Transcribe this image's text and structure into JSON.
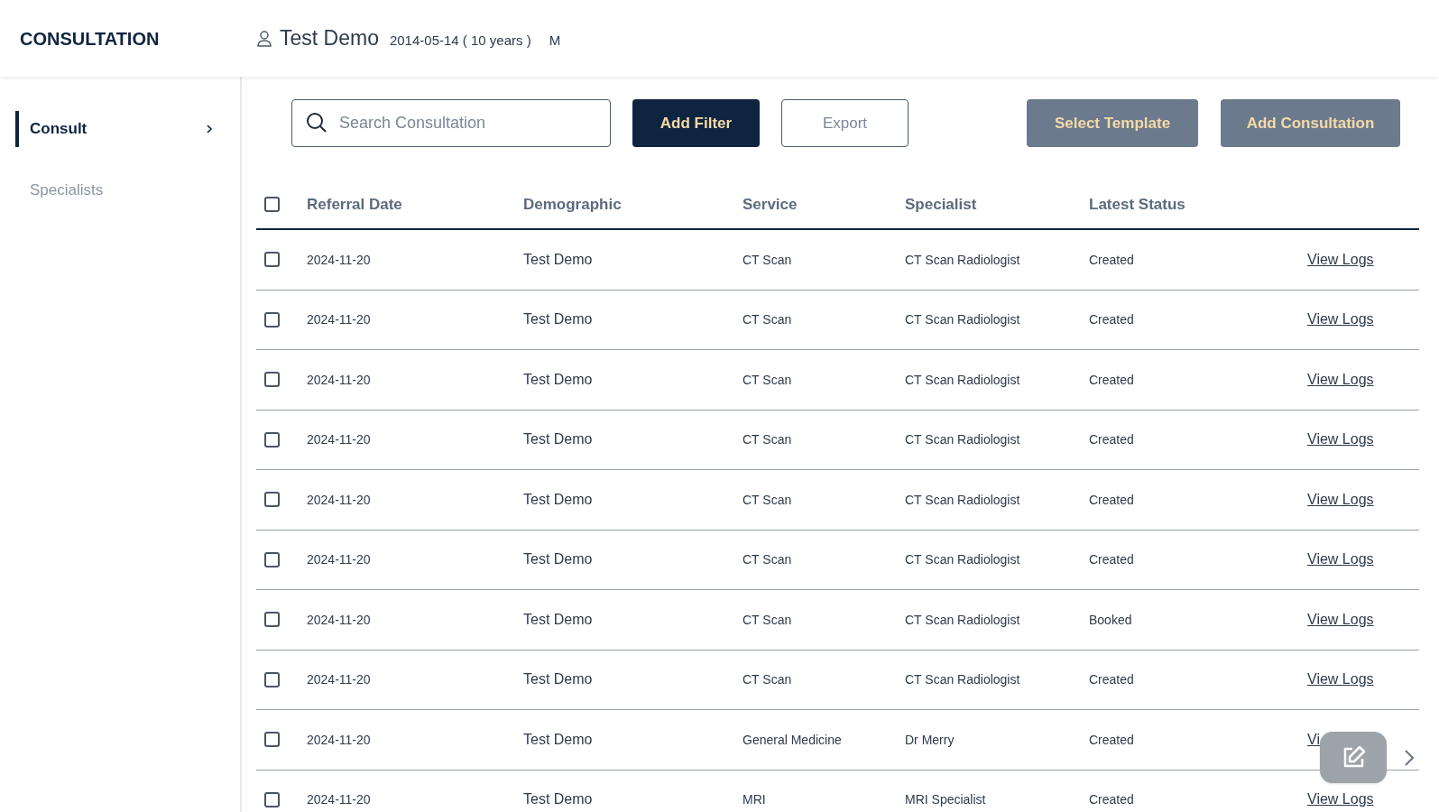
{
  "app_title": "CONSULTATION",
  "patient": {
    "name": "Test Demo",
    "dob": "2014-05-14 ( 10 years )",
    "sex": "M"
  },
  "sidebar": {
    "items": [
      {
        "label": "Consult",
        "selected": true
      },
      {
        "label": "Specialists",
        "selected": false
      }
    ]
  },
  "search": {
    "placeholder": "Search Consultation"
  },
  "buttons": [
    {
      "label": "Add Filter",
      "kind": "primary"
    },
    {
      "label": "Export",
      "kind": "outline"
    },
    {
      "label": "Select Template",
      "kind": "muted"
    },
    {
      "label": "Add Consultation",
      "kind": "muted"
    }
  ],
  "table": {
    "select_all_checked": false,
    "columns": [
      "Referral Date",
      "Demographic",
      "Service",
      "Specialist",
      "Latest Status"
    ],
    "rows": [
      {
        "checked": false,
        "cells": [
          "2024-11-20",
          "Test Demo",
          "CT Scan",
          "CT Scan Radiologist",
          "Created"
        ],
        "link": "View Logs"
      },
      {
        "checked": false,
        "cells": [
          "2024-11-20",
          "Test Demo",
          "CT Scan",
          "CT Scan Radiologist",
          "Created"
        ],
        "link": "View Logs"
      },
      {
        "checked": false,
        "cells": [
          "2024-11-20",
          "Test Demo",
          "CT Scan",
          "CT Scan Radiologist",
          "Created"
        ],
        "link": "View Logs"
      },
      {
        "checked": false,
        "cells": [
          "2024-11-20",
          "Test Demo",
          "CT Scan",
          "CT Scan Radiologist",
          "Created"
        ],
        "link": "View Logs"
      },
      {
        "checked": false,
        "cells": [
          "2024-11-20",
          "Test Demo",
          "CT Scan",
          "CT Scan Radiologist",
          "Created"
        ],
        "link": "View Logs"
      },
      {
        "checked": false,
        "cells": [
          "2024-11-20",
          "Test Demo",
          "CT Scan",
          "CT Scan Radiologist",
          "Created"
        ],
        "link": "View Logs"
      },
      {
        "checked": false,
        "cells": [
          "2024-11-20",
          "Test Demo",
          "CT Scan",
          "CT Scan Radiologist",
          "Booked"
        ],
        "link": "View Logs"
      },
      {
        "checked": false,
        "cells": [
          "2024-11-20",
          "Test Demo",
          "CT Scan",
          "CT Scan Radiologist",
          "Created"
        ],
        "link": "View Logs"
      },
      {
        "checked": false,
        "cells": [
          "2024-11-20",
          "Test Demo",
          "General Medicine",
          "Dr Merry",
          "Created"
        ],
        "link": "Vi"
      },
      {
        "checked": false,
        "cells": [
          "2024-11-20",
          "Test Demo",
          "MRI",
          "MRI Specialist",
          "Created"
        ],
        "link": "View Logs"
      }
    ]
  }
}
